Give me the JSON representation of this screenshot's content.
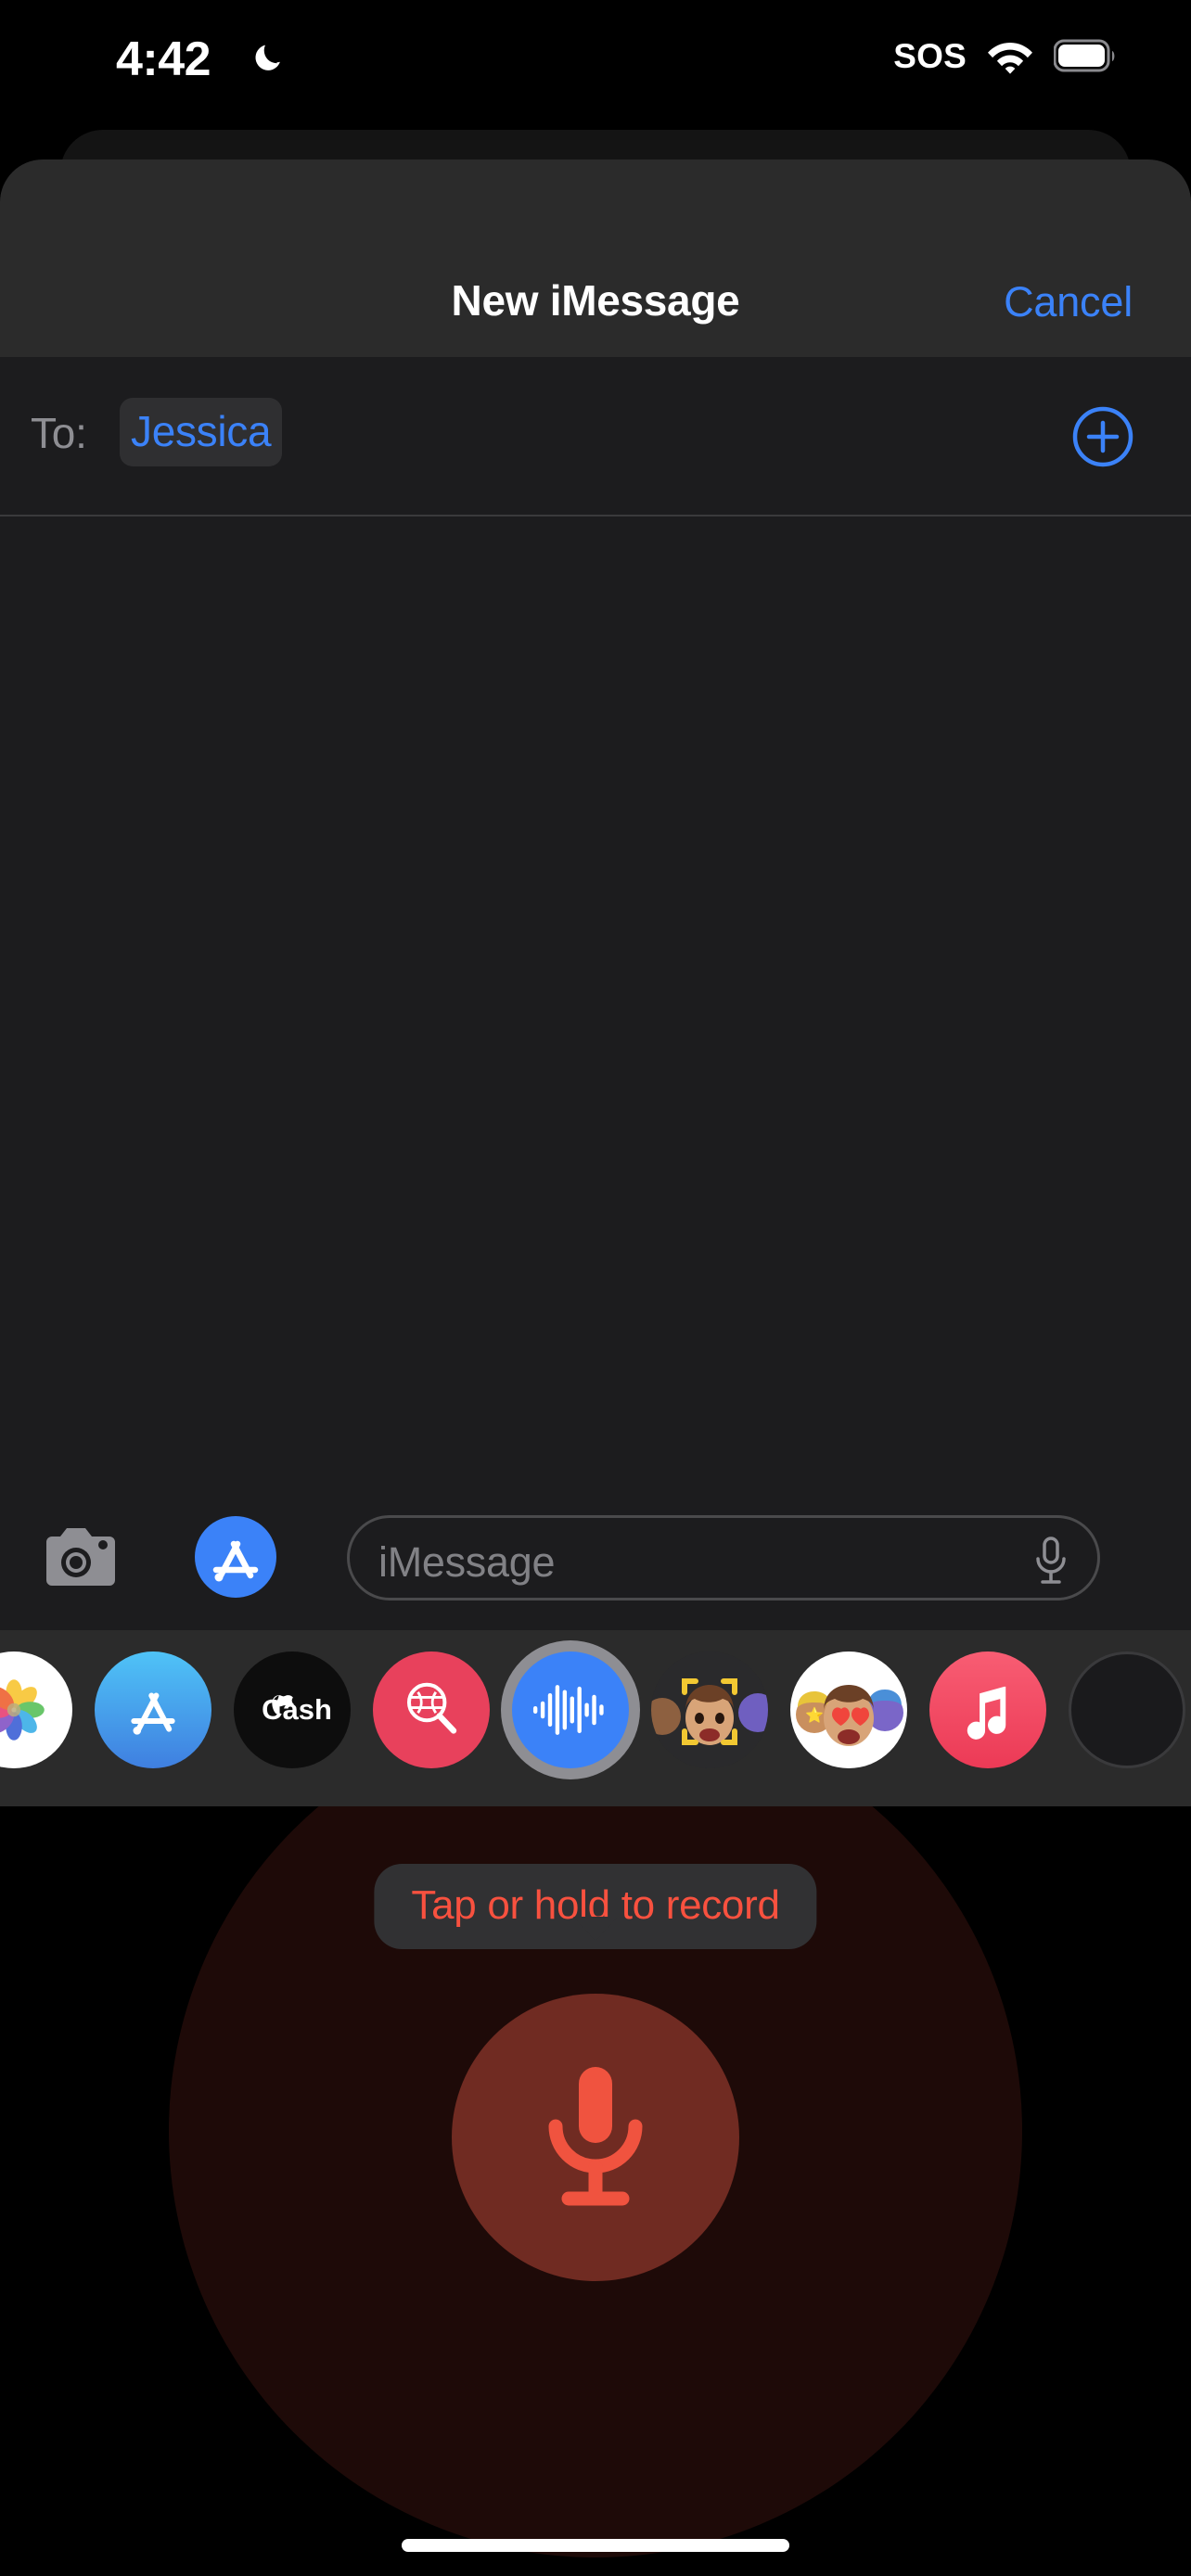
{
  "status_bar": {
    "time": "4:42",
    "dnd_icon": "crescent-moon-icon",
    "sos_label": "SOS",
    "wifi_icon": "wifi-icon",
    "battery_icon": "battery-full-icon"
  },
  "nav": {
    "title": "New iMessage",
    "cancel_label": "Cancel"
  },
  "to_field": {
    "label": "To:",
    "recipient": "Jessica",
    "add_contact_icon": "plus-circle-icon"
  },
  "input_bar": {
    "camera_icon": "camera-icon",
    "appstore_icon": "app-store-icon",
    "placeholder": "iMessage",
    "value": "",
    "mic_icon": "microphone-icon"
  },
  "app_drawer": {
    "apps": [
      {
        "name": "Photos",
        "icon": "photos-icon",
        "selected": false
      },
      {
        "name": "App Store",
        "icon": "app-store-icon",
        "selected": false
      },
      {
        "name": "Apple Cash",
        "icon": "apple-cash-icon",
        "label": "Cash",
        "selected": false
      },
      {
        "name": "#images",
        "icon": "hash-images-icon",
        "selected": false
      },
      {
        "name": "Audio",
        "icon": "audio-waveform-icon",
        "selected": true
      },
      {
        "name": "Memoji",
        "icon": "memoji-camera-icon",
        "selected": false
      },
      {
        "name": "Memoji Stickers",
        "icon": "memoji-stickers-icon",
        "selected": false
      },
      {
        "name": "Music",
        "icon": "music-note-icon",
        "selected": false
      },
      {
        "name": "More",
        "icon": "more-app-icon",
        "selected": false
      }
    ],
    "handle": "drag-handle"
  },
  "record_overlay": {
    "tooltip": "Tap or hold to record",
    "record_icon": "microphone-icon"
  },
  "colors": {
    "accent_blue": "#3b82f8",
    "record_red": "#f8513f",
    "record_button_bg": "#702b22",
    "sheet_bg": "#1c1c1e",
    "nav_bg": "#2b2b2b",
    "drawer_bg": "#2b2b2b"
  }
}
